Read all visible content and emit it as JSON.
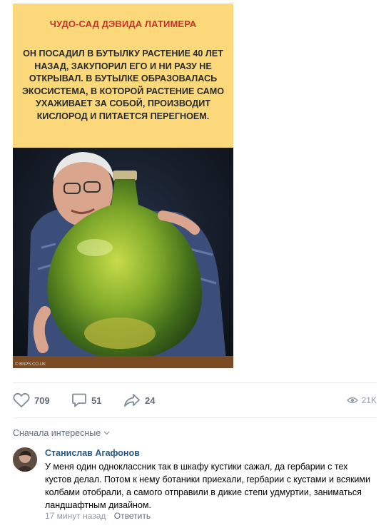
{
  "post": {
    "card_title": "ЧУДО-САД ДЭВИДА ЛАТИМЕРА",
    "card_text": "ОН ПОСАДИЛ В БУТЫЛКУ РАСТЕНИЕ 40 ЛЕТ НАЗАД, ЗАКУПОРИЛ ЕГО И НИ РАЗУ НЕ ОТКРЫВАЛ. В БУТЫЛКЕ ОБРАЗОВАЛАСЬ ЭКОСИСТЕМА, В КОТОРОЙ РАСТЕНИЕ САМО УХАЖИВАЕТ ЗА СОБОЙ, ПРОИЗВОДИТ КИСЛОРОД И ПИТАЕТСЯ ПЕРЕГНОЕМ.",
    "watermark": "© BNPS.CO.UK"
  },
  "actions": {
    "likes": "709",
    "comments": "51",
    "shares": "24",
    "views": "21K"
  },
  "comments_sort": "Сначала интересные",
  "comment": {
    "author": "Станислав Агафонов",
    "text": "У меня один одноклассник так в шкафу кустики сажал, да гербарии с тех кустов делал. Потом к нему ботаники приехали, гербарии с кустами и всякими колбами отобрали, а самого отправили в дикие степи удмуртии, заниматься ландшафтным дизайном.",
    "time": "17 минут назад",
    "reply_label": "Ответить"
  },
  "colors": {
    "card_background": "#fbd87a",
    "card_title": "#c9332d",
    "link": "#2a5885",
    "muted": "#939cab",
    "action": "#626d7a"
  }
}
